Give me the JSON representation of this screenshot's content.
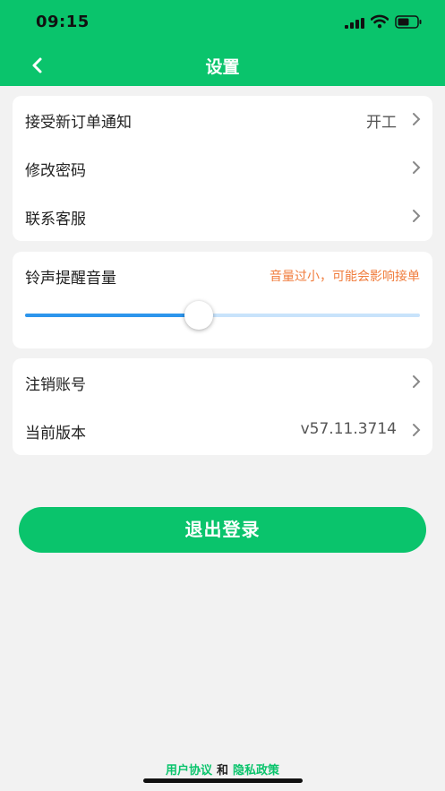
{
  "status_bar": {
    "time": "09:15"
  },
  "nav": {
    "title": "设置"
  },
  "group1": {
    "rows": [
      {
        "label": "接受新订单通知",
        "value": "开工"
      },
      {
        "label": "修改密码",
        "value": ""
      },
      {
        "label": "联系客服",
        "value": ""
      }
    ]
  },
  "volume": {
    "label": "铃声提醒音量",
    "warning": "音量过小，可能会影响接单",
    "level": 0.44
  },
  "group2": {
    "rows": [
      {
        "label": "注销账号",
        "value": ""
      },
      {
        "label": "当前版本",
        "value": "v57.11.3714"
      }
    ]
  },
  "logout_label": "退出登录",
  "footer": {
    "agreement": "用户协议",
    "and": "和",
    "privacy": "隐私政策"
  },
  "colors": {
    "accent": "#0ac46c",
    "slider": "#2d95ec",
    "warning": "#f07c3c"
  }
}
